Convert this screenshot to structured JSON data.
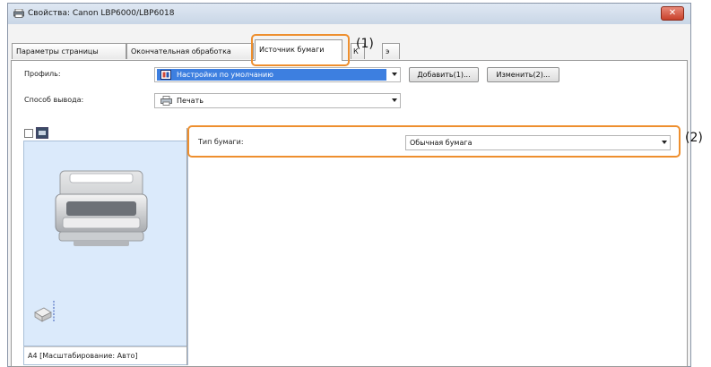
{
  "window": {
    "title": "Свойства: Canon LBP6000/LBP6018",
    "close_label": "✕"
  },
  "tabs": [
    {
      "label": "Параметры страницы"
    },
    {
      "label": "Окончательная обработка"
    },
    {
      "label": "Источник бумаги"
    },
    {
      "label": "К"
    },
    {
      "label": "э"
    }
  ],
  "profile": {
    "label": "Профиль:",
    "value": "Настройки по умолчанию",
    "add_button": "Добавить(1)...",
    "edit_button": "Изменить(2)..."
  },
  "output": {
    "label": "Способ вывода:",
    "value": "Печать"
  },
  "paper_type": {
    "label": "Тип бумаги:",
    "value": "Обычная бумага"
  },
  "preview": {
    "status": "A4 [Масштабирование: Авто]"
  },
  "annotations": [
    {
      "label": "(1)"
    },
    {
      "label": "(2)"
    }
  ],
  "colors": {
    "accent_orange": "#ee8f2e",
    "selection_blue": "#3d7fe0",
    "preview_bg": "#dbeafb"
  }
}
